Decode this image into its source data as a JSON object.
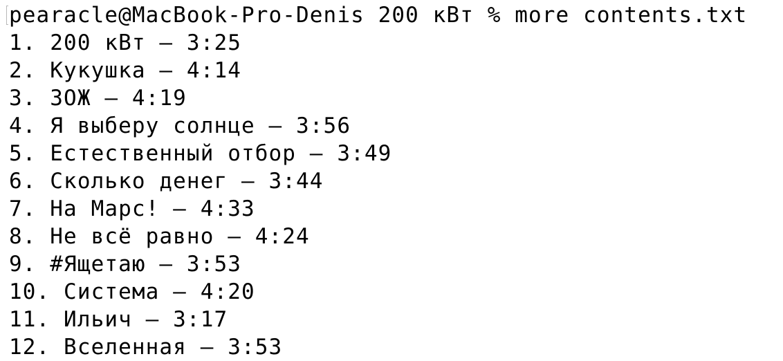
{
  "terminal": {
    "prompt": "pearacle@MacBook-Pro-Denis 200 кВт % more contents.txt",
    "output": [
      "1. 200 кВт – 3:25",
      "2. Кукушка – 4:14",
      "3. ЗОЖ – 4:19",
      "4. Я выберу солнце – 3:56",
      "5. Естественный отбор – 3:49",
      "6. Сколько денег – 3:44",
      "7. На Марс! – 4:33",
      "8. Не всё равно – 4:24",
      "9. #Ящетаю – 3:53",
      "10. Система – 4:20",
      "11. Ильич – 3:17",
      "12. Вселенная – 3:53"
    ]
  }
}
